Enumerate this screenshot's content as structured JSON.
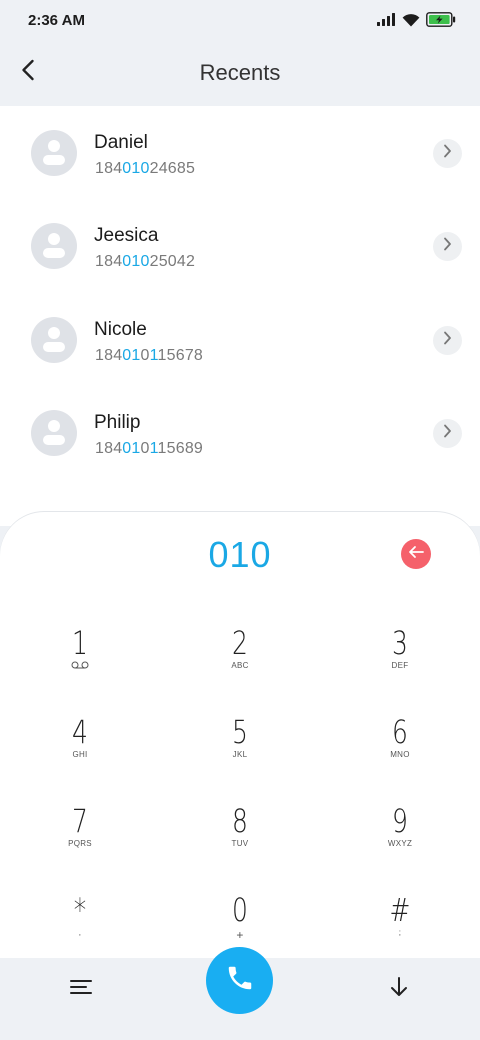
{
  "status_bar": {
    "time": "2:36 AM",
    "icons": [
      "signal-icon",
      "wifi-icon",
      "battery-charging-icon"
    ],
    "battery_color": "#3cbf4b"
  },
  "header": {
    "title": "Recents",
    "back_icon": "chevron-left-icon"
  },
  "contacts": [
    {
      "name": "Daniel",
      "number_prefix": "184",
      "number_match": "010",
      "number_suffix": "24685"
    },
    {
      "name": "Jeesica",
      "number_prefix": "184",
      "number_match": "010",
      "number_suffix": "25042"
    },
    {
      "name": "Nicole",
      "number_prefix": "184",
      "number_match": "01",
      "number_mid": "0",
      "number_suffix": "15678"
    },
    {
      "name": "Philip",
      "number_prefix": "184",
      "number_match": "01",
      "number_mid": "0",
      "number_suffix": "15689"
    }
  ],
  "dialer": {
    "typed_number": "010",
    "delete_icon": "backspace-arrow-icon",
    "keys": [
      {
        "digit": "1",
        "letters": "",
        "icon": "voicemail-icon"
      },
      {
        "digit": "2",
        "letters": "ABC"
      },
      {
        "digit": "3",
        "letters": "DEF"
      },
      {
        "digit": "4",
        "letters": "GHI"
      },
      {
        "digit": "5",
        "letters": "JKL"
      },
      {
        "digit": "6",
        "letters": "MNO"
      },
      {
        "digit": "7",
        "letters": "PQRS"
      },
      {
        "digit": "8",
        "letters": "TUV"
      },
      {
        "digit": "9",
        "letters": "WXYZ"
      },
      {
        "digit": "*",
        "letters": ","
      },
      {
        "digit": "0",
        "letters": "+"
      },
      {
        "digit": "#",
        "letters": ";"
      }
    ]
  },
  "bottom_bar": {
    "menu_icon": "menu-lines-icon",
    "call_icon": "phone-icon",
    "hide_icon": "arrow-down-icon",
    "accent": "#19aef2"
  },
  "colors": {
    "highlight": "#1aa8e5",
    "delete": "#f5616b"
  }
}
